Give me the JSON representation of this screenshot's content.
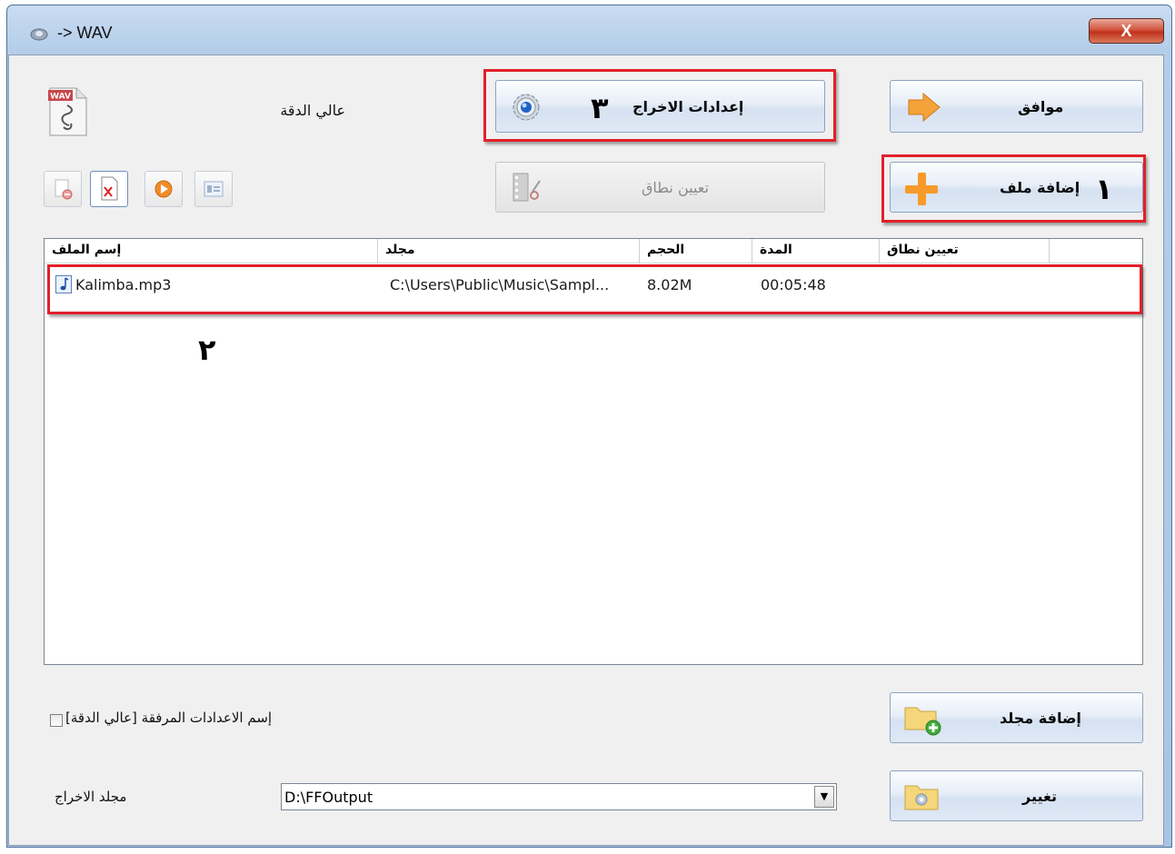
{
  "window": {
    "title": "-> WAV",
    "close_label": "X"
  },
  "profile": {
    "name": "عالي الدقة",
    "format_badge": "WAV"
  },
  "buttons": {
    "ok": "موافق",
    "output_settings": "إعدادات الاخراج",
    "add_file": "إضافة ملف",
    "set_range": "تعيين نطاق",
    "add_folder": "إضافة مجلد",
    "change": "تغيير"
  },
  "annotations": {
    "step1": "١",
    "step2": "٢",
    "step3": "٣"
  },
  "list": {
    "columns": [
      "إسم الملف",
      "مجلد",
      "الحجم",
      "المدة",
      "تعيين نطاق"
    ],
    "rows": [
      {
        "name": "Kalimba.mp3",
        "folder": "C:\\Users\\Public\\Music\\Sampl...",
        "size": "8.02M",
        "duration": "00:05:48",
        "range": ""
      }
    ]
  },
  "append_setting_label": "[إسم الاعدادات المرفقة [عالي الدقة",
  "output": {
    "label": "مجلد الاخراج",
    "path": "D:\\FFOutput"
  },
  "icons": {
    "toolbar": [
      "remove-icon",
      "clear-list-icon",
      "play-icon",
      "media-info-icon"
    ],
    "title": "app-icon",
    "ok": "arrow-right-icon",
    "add_file": "plus-icon",
    "settings": "gear-icon",
    "range": "film-scissors-icon",
    "add_folder": "folder-add-icon",
    "change": "folder-open-icon",
    "row": "music-note-icon"
  }
}
